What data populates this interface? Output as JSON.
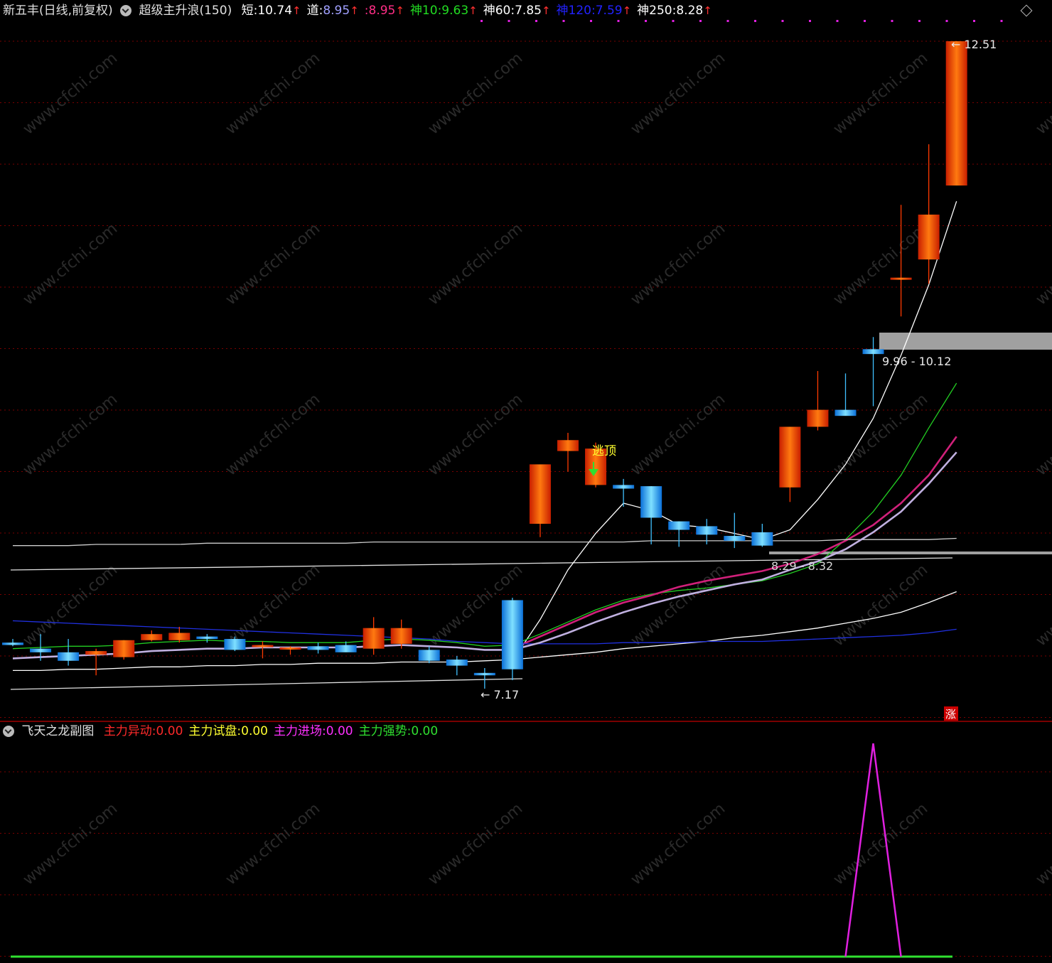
{
  "main_header": {
    "stock_title": "新五丰(日线,前复权)",
    "indicator_name": "超级主升浪(150)",
    "items": [
      {
        "label": "短:",
        "value": "10.74",
        "color": "#ffffff",
        "value_color": "#ffffff"
      },
      {
        "label": "道:",
        "value": "8.95",
        "color": "#ffffff",
        "value_color": "#a0a0ff"
      },
      {
        "label": ":",
        "value": "8.95",
        "color": "#ff2e86",
        "value_color": "#ff2e86"
      },
      {
        "label": "神10:",
        "value": "9.63",
        "color": "#22dd22",
        "value_color": "#22dd22"
      },
      {
        "label": "神60:",
        "value": "7.85",
        "color": "#ffffff",
        "value_color": "#ffffff"
      },
      {
        "label": "神120:",
        "value": "7.59",
        "color": "#2222ff",
        "value_color": "#2222ff"
      },
      {
        "label": "神250:",
        "value": "8.28",
        "color": "#ffffff",
        "value_color": "#ffffff"
      }
    ],
    "arrow": "↑"
  },
  "sub_header": {
    "title": "飞天之龙副图",
    "items": [
      {
        "label": "主力异动:",
        "value": "0.00",
        "color": "#ff2a2a"
      },
      {
        "label": "主力试盘:",
        "value": "0.00",
        "color": "#ffff30"
      },
      {
        "label": "主力进场:",
        "value": "0.00",
        "color": "#ff30ff"
      },
      {
        "label": "主力强势:",
        "value": "0.00",
        "color": "#30e030"
      }
    ]
  },
  "annotations": {
    "high": "12.51",
    "low": "7.17",
    "zone_upper": "9.96 - 10.12",
    "zone_lower": "8.29 - 8.32",
    "signal": "逃顶",
    "rise_tag": "涨"
  },
  "watermark": "www.cfchi.com",
  "colors": {
    "up_candle": "#ff5a00",
    "down_candle": "#1ea8ff",
    "grid": "#7a0000",
    "white_line": "#ffffff",
    "green_line": "#22cc22",
    "magenta_line": "#d0207a",
    "blue_line": "#2030e0",
    "gray_line": "#bbbbbb",
    "sub_magenta": "#e020e0",
    "sub_green": "#30e030"
  },
  "chart_data": [
    {
      "type": "candlestick",
      "title": "超级主升浪(150)",
      "price_range": [
        6.9,
        12.8
      ],
      "candles": [
        {
          "o": 7.55,
          "h": 7.58,
          "l": 7.52,
          "c": 7.53
        },
        {
          "o": 7.5,
          "h": 7.62,
          "l": 7.4,
          "c": 7.47
        },
        {
          "o": 7.47,
          "h": 7.58,
          "l": 7.36,
          "c": 7.4
        },
        {
          "o": 7.45,
          "h": 7.5,
          "l": 7.28,
          "c": 7.48
        },
        {
          "o": 7.43,
          "h": 7.57,
          "l": 7.41,
          "c": 7.57
        },
        {
          "o": 7.57,
          "h": 7.65,
          "l": 7.56,
          "c": 7.62
        },
        {
          "o": 7.57,
          "h": 7.68,
          "l": 7.55,
          "c": 7.63
        },
        {
          "o": 7.6,
          "h": 7.62,
          "l": 7.55,
          "c": 7.58
        },
        {
          "o": 7.58,
          "h": 7.6,
          "l": 7.48,
          "c": 7.49
        },
        {
          "o": 7.52,
          "h": 7.56,
          "l": 7.42,
          "c": 7.53
        },
        {
          "o": 7.5,
          "h": 7.52,
          "l": 7.45,
          "c": 7.51
        },
        {
          "o": 7.52,
          "h": 7.55,
          "l": 7.46,
          "c": 7.49
        },
        {
          "o": 7.53,
          "h": 7.56,
          "l": 7.48,
          "c": 7.47
        },
        {
          "o": 7.5,
          "h": 7.76,
          "l": 7.45,
          "c": 7.67
        },
        {
          "o": 7.54,
          "h": 7.74,
          "l": 7.5,
          "c": 7.67
        },
        {
          "o": 7.49,
          "h": 7.52,
          "l": 7.38,
          "c": 7.4
        },
        {
          "o": 7.41,
          "h": 7.44,
          "l": 7.28,
          "c": 7.36
        },
        {
          "o": 7.3,
          "h": 7.34,
          "l": 7.17,
          "c": 7.28
        },
        {
          "o": 7.9,
          "h": 7.92,
          "l": 7.24,
          "c": 7.33
        },
        {
          "o": 8.53,
          "h": 8.96,
          "l": 8.42,
          "c": 9.02
        },
        {
          "o": 9.13,
          "h": 9.28,
          "l": 8.96,
          "c": 9.22
        },
        {
          "o": 8.85,
          "h": 9.2,
          "l": 8.83,
          "c": 9.15
        },
        {
          "o": 8.85,
          "h": 8.9,
          "l": 8.67,
          "c": 8.82
        },
        {
          "o": 8.84,
          "h": 8.84,
          "l": 8.36,
          "c": 8.58
        },
        {
          "o": 8.55,
          "h": 8.55,
          "l": 8.34,
          "c": 8.48
        },
        {
          "o": 8.51,
          "h": 8.57,
          "l": 8.36,
          "c": 8.44
        },
        {
          "o": 8.43,
          "h": 8.62,
          "l": 8.33,
          "c": 8.39
        },
        {
          "o": 8.46,
          "h": 8.53,
          "l": 8.34,
          "c": 8.35
        },
        {
          "o": 8.83,
          "h": 9.33,
          "l": 8.71,
          "c": 9.33
        },
        {
          "o": 9.33,
          "h": 9.79,
          "l": 9.3,
          "c": 9.47
        },
        {
          "o": 9.47,
          "h": 9.77,
          "l": 9.43,
          "c": 9.42
        },
        {
          "o": 9.97,
          "h": 10.07,
          "l": 9.5,
          "c": 9.93
        },
        {
          "o": 10.56,
          "h": 11.16,
          "l": 10.24,
          "c": 10.56
        },
        {
          "o": 10.71,
          "h": 11.66,
          "l": 10.51,
          "c": 11.08
        },
        {
          "o": 11.32,
          "h": 12.51,
          "l": 11.33,
          "c": 12.51
        }
      ],
      "lines": [
        {
          "name": "短",
          "color": "#ffffff",
          "values": [
            null,
            null,
            null,
            null,
            null,
            null,
            null,
            null,
            null,
            null,
            null,
            null,
            null,
            null,
            null,
            null,
            null,
            null,
            7.4,
            7.74,
            8.15,
            8.45,
            8.7,
            8.64,
            8.52,
            8.5,
            8.45,
            8.4,
            8.48,
            8.73,
            9.02,
            9.4,
            9.92,
            10.5,
            11.19
          ]
        },
        {
          "name": "神10",
          "color": "#22cc22",
          "values": [
            7.5,
            7.51,
            7.52,
            7.52,
            7.53,
            7.55,
            7.56,
            7.57,
            7.56,
            7.56,
            7.55,
            7.55,
            7.55,
            7.57,
            7.58,
            7.57,
            7.55,
            7.52,
            7.53,
            7.62,
            7.72,
            7.82,
            7.9,
            7.95,
            7.98,
            8.0,
            8.03,
            8.06,
            8.12,
            8.2,
            8.4,
            8.63,
            8.93,
            9.32,
            9.69
          ]
        },
        {
          "name": "道",
          "color": "#d0207a",
          "values": [
            null,
            null,
            null,
            null,
            null,
            null,
            null,
            null,
            null,
            null,
            null,
            null,
            null,
            null,
            null,
            null,
            null,
            null,
            7.5,
            7.6,
            7.7,
            7.8,
            7.88,
            7.94,
            8.01,
            8.06,
            8.1,
            8.14,
            8.2,
            8.28,
            8.39,
            8.52,
            8.7,
            8.93,
            9.25
          ]
        },
        {
          "name": "神250",
          "color": "#ffffff",
          "values": [
            7.32,
            7.32,
            7.33,
            7.33,
            7.34,
            7.35,
            7.35,
            7.36,
            7.36,
            7.37,
            7.37,
            7.38,
            7.38,
            7.38,
            7.39,
            7.39,
            7.39,
            7.4,
            7.41,
            7.43,
            7.45,
            7.47,
            7.5,
            7.52,
            7.54,
            7.56,
            7.59,
            7.61,
            7.64,
            7.67,
            7.71,
            7.75,
            7.8,
            7.88,
            7.97
          ]
        },
        {
          "name": "神120",
          "color": "#2030e0",
          "values": [
            7.73,
            7.72,
            7.71,
            7.7,
            7.69,
            7.68,
            7.67,
            7.66,
            7.65,
            7.64,
            7.63,
            7.62,
            7.61,
            7.6,
            7.59,
            7.58,
            7.56,
            7.55,
            7.54,
            7.54,
            7.54,
            7.54,
            7.55,
            7.55,
            7.55,
            7.56,
            7.56,
            7.56,
            7.57,
            7.58,
            7.59,
            7.6,
            7.61,
            7.63,
            7.66
          ]
        },
        {
          "name": "神60",
          "color": "#cccccc",
          "values": [
            8.35,
            8.35,
            8.35,
            8.36,
            8.36,
            8.36,
            8.36,
            8.37,
            8.37,
            8.37,
            8.37,
            8.37,
            8.37,
            8.38,
            8.38,
            8.38,
            8.38,
            8.38,
            8.38,
            8.38,
            8.38,
            8.38,
            8.38,
            8.39,
            8.39,
            8.39,
            8.39,
            8.39,
            8.39,
            8.39,
            8.4,
            8.4,
            8.4,
            8.4,
            8.41
          ]
        },
        {
          "name": "均价",
          "color": "#c0b0e0",
          "values": [
            7.42,
            7.43,
            7.44,
            7.45,
            7.46,
            7.48,
            7.49,
            7.5,
            7.5,
            7.51,
            7.51,
            7.51,
            7.51,
            7.52,
            7.53,
            7.52,
            7.51,
            7.49,
            7.49,
            7.55,
            7.63,
            7.72,
            7.8,
            7.87,
            7.93,
            7.98,
            8.03,
            8.07,
            8.15,
            8.22,
            8.32,
            8.46,
            8.63,
            8.86,
            9.12
          ]
        }
      ]
    },
    {
      "type": "line",
      "title": "飞天之龙副图",
      "series": [
        {
          "name": "主力进场",
          "color": "#e020e0",
          "values": [
            0,
            0,
            0,
            0,
            0,
            0,
            0,
            0,
            0,
            0,
            0,
            0,
            0,
            0,
            0,
            0,
            0,
            0,
            0,
            0,
            0,
            0,
            0,
            0,
            0,
            0,
            0,
            0,
            0,
            0,
            0,
            1,
            0,
            0,
            0
          ]
        },
        {
          "name": "主力强势",
          "color": "#30e030",
          "values": [
            0,
            0,
            0,
            0,
            0,
            0,
            0,
            0,
            0,
            0,
            0,
            0,
            0,
            0,
            0,
            0,
            0,
            0,
            0,
            0,
            0,
            0,
            0,
            0,
            0,
            0,
            0,
            0,
            0,
            0,
            0,
            0,
            0,
            0,
            0
          ]
        }
      ]
    }
  ]
}
